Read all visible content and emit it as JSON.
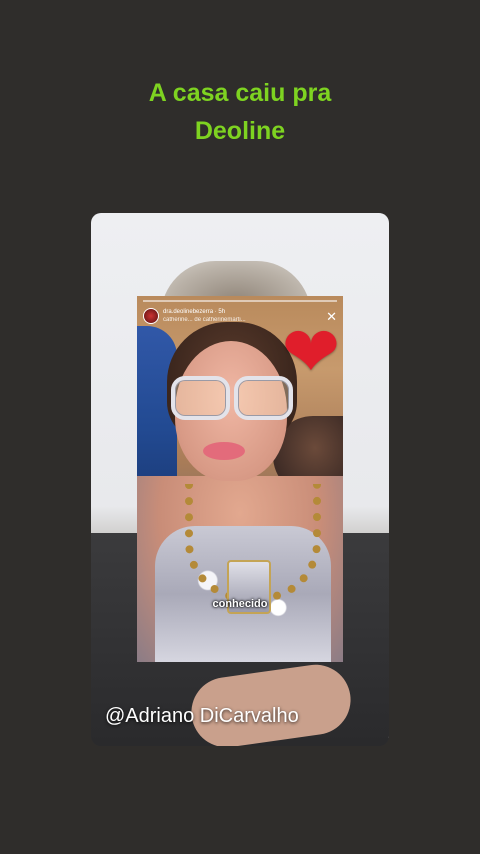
{
  "headline": {
    "line1": "A casa caiu pra",
    "line2": "Deoline"
  },
  "story": {
    "username": "dra.deolinebezerra",
    "time": "5h",
    "subline": "catherine... de catherinemarti...",
    "caption": "conhecido",
    "close_icon": "close-icon",
    "sticker_icon": "heart-sticker-icon"
  },
  "credit": "@Adriano DiCarvalho",
  "colors": {
    "background": "#2f2d2b",
    "headline": "#7ed321",
    "heart": "#e01e2b"
  }
}
